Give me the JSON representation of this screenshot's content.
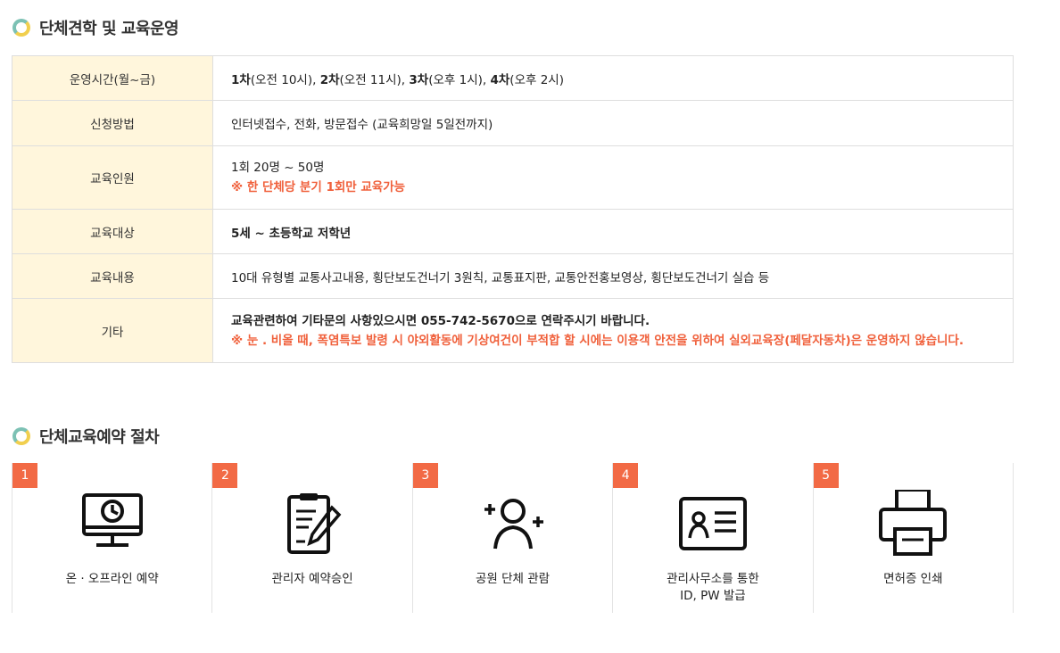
{
  "section1": {
    "title": "단체견학 및 교육운영"
  },
  "table": {
    "hours_label": "운영시간(월~금)",
    "hours": [
      {
        "bold": "1차",
        "text": "(오전 10시), "
      },
      {
        "bold": "2차",
        "text": "(오전 11시), "
      },
      {
        "bold": "3차",
        "text": "(오후 1시), "
      },
      {
        "bold": "4차",
        "text": "(오후 2시)"
      }
    ],
    "apply_label": "신청방법",
    "apply_value": "인터넷접수, 전화, 방문접수 (교육희망일 5일전까지)",
    "people_label": "교육인원",
    "people_value": "1회 20명 ~ 50명",
    "people_note": "※ 한 단체당 분기 1회만 교육가능",
    "target_label": "교육대상",
    "target_value": "5세 ~ 초등학교 저학년",
    "content_label": "교육내용",
    "content_value": "10대 유형별 교통사고내용, 횡단보도건너기 3원칙, 교통표지판, 교통안전홍보영상, 횡단보도건너기 실습 등",
    "etc_label": "기타",
    "etc_value": "교육관련하여 기타문의 사항있으시면 055-742-5670으로 연락주시기 바랍니다.",
    "etc_note": "※ 눈 . 비올 때, 폭염특보 발령 시 야외활동에 기상여건이 부적합 할 시에는 이용객 안전을 위하여 실외교육장(페달자동차)은 운영하지 않습니다."
  },
  "section2": {
    "title": "단체교육예약 절차"
  },
  "steps": [
    {
      "num": "1",
      "label": "온 · 오프라인 예약",
      "icon": "monitor-clock-icon"
    },
    {
      "num": "2",
      "label": "관리자 예약승인",
      "icon": "clipboard-pen-icon"
    },
    {
      "num": "3",
      "label": "공원 단체 관람",
      "icon": "group-user-icon"
    },
    {
      "num": "4",
      "label": "관리사무소를 통한\nID, PW 발급",
      "icon": "id-card-icon"
    },
    {
      "num": "5",
      "label": "면허증 인쇄",
      "icon": "printer-icon"
    }
  ],
  "colors": {
    "accent": "#f26a45",
    "header_bg": "#fff6dc",
    "note_red": "#f0603b"
  }
}
